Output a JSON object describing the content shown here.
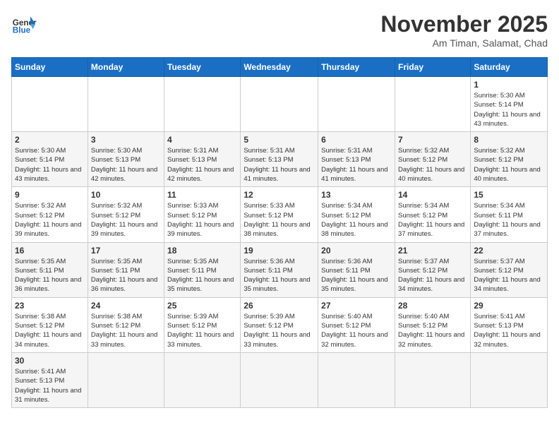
{
  "header": {
    "logo_general": "General",
    "logo_blue": "Blue",
    "month_title": "November 2025",
    "subtitle": "Am Timan, Salamat, Chad"
  },
  "weekdays": [
    "Sunday",
    "Monday",
    "Tuesday",
    "Wednesday",
    "Thursday",
    "Friday",
    "Saturday"
  ],
  "weeks": [
    [
      {
        "day": "",
        "info": ""
      },
      {
        "day": "",
        "info": ""
      },
      {
        "day": "",
        "info": ""
      },
      {
        "day": "",
        "info": ""
      },
      {
        "day": "",
        "info": ""
      },
      {
        "day": "",
        "info": ""
      },
      {
        "day": "1",
        "info": "Sunrise: 5:30 AM\nSunset: 5:14 PM\nDaylight: 11 hours and 43 minutes."
      }
    ],
    [
      {
        "day": "2",
        "info": "Sunrise: 5:30 AM\nSunset: 5:14 PM\nDaylight: 11 hours and 43 minutes."
      },
      {
        "day": "3",
        "info": "Sunrise: 5:30 AM\nSunset: 5:13 PM\nDaylight: 11 hours and 42 minutes."
      },
      {
        "day": "4",
        "info": "Sunrise: 5:31 AM\nSunset: 5:13 PM\nDaylight: 11 hours and 42 minutes."
      },
      {
        "day": "5",
        "info": "Sunrise: 5:31 AM\nSunset: 5:13 PM\nDaylight: 11 hours and 41 minutes."
      },
      {
        "day": "6",
        "info": "Sunrise: 5:31 AM\nSunset: 5:13 PM\nDaylight: 11 hours and 41 minutes."
      },
      {
        "day": "7",
        "info": "Sunrise: 5:32 AM\nSunset: 5:12 PM\nDaylight: 11 hours and 40 minutes."
      },
      {
        "day": "8",
        "info": "Sunrise: 5:32 AM\nSunset: 5:12 PM\nDaylight: 11 hours and 40 minutes."
      }
    ],
    [
      {
        "day": "9",
        "info": "Sunrise: 5:32 AM\nSunset: 5:12 PM\nDaylight: 11 hours and 39 minutes."
      },
      {
        "day": "10",
        "info": "Sunrise: 5:32 AM\nSunset: 5:12 PM\nDaylight: 11 hours and 39 minutes."
      },
      {
        "day": "11",
        "info": "Sunrise: 5:33 AM\nSunset: 5:12 PM\nDaylight: 11 hours and 39 minutes."
      },
      {
        "day": "12",
        "info": "Sunrise: 5:33 AM\nSunset: 5:12 PM\nDaylight: 11 hours and 38 minutes."
      },
      {
        "day": "13",
        "info": "Sunrise: 5:34 AM\nSunset: 5:12 PM\nDaylight: 11 hours and 38 minutes."
      },
      {
        "day": "14",
        "info": "Sunrise: 5:34 AM\nSunset: 5:12 PM\nDaylight: 11 hours and 37 minutes."
      },
      {
        "day": "15",
        "info": "Sunrise: 5:34 AM\nSunset: 5:11 PM\nDaylight: 11 hours and 37 minutes."
      }
    ],
    [
      {
        "day": "16",
        "info": "Sunrise: 5:35 AM\nSunset: 5:11 PM\nDaylight: 11 hours and 36 minutes."
      },
      {
        "day": "17",
        "info": "Sunrise: 5:35 AM\nSunset: 5:11 PM\nDaylight: 11 hours and 36 minutes."
      },
      {
        "day": "18",
        "info": "Sunrise: 5:35 AM\nSunset: 5:11 PM\nDaylight: 11 hours and 35 minutes."
      },
      {
        "day": "19",
        "info": "Sunrise: 5:36 AM\nSunset: 5:11 PM\nDaylight: 11 hours and 35 minutes."
      },
      {
        "day": "20",
        "info": "Sunrise: 5:36 AM\nSunset: 5:11 PM\nDaylight: 11 hours and 35 minutes."
      },
      {
        "day": "21",
        "info": "Sunrise: 5:37 AM\nSunset: 5:12 PM\nDaylight: 11 hours and 34 minutes."
      },
      {
        "day": "22",
        "info": "Sunrise: 5:37 AM\nSunset: 5:12 PM\nDaylight: 11 hours and 34 minutes."
      }
    ],
    [
      {
        "day": "23",
        "info": "Sunrise: 5:38 AM\nSunset: 5:12 PM\nDaylight: 11 hours and 34 minutes."
      },
      {
        "day": "24",
        "info": "Sunrise: 5:38 AM\nSunset: 5:12 PM\nDaylight: 11 hours and 33 minutes."
      },
      {
        "day": "25",
        "info": "Sunrise: 5:39 AM\nSunset: 5:12 PM\nDaylight: 11 hours and 33 minutes."
      },
      {
        "day": "26",
        "info": "Sunrise: 5:39 AM\nSunset: 5:12 PM\nDaylight: 11 hours and 33 minutes."
      },
      {
        "day": "27",
        "info": "Sunrise: 5:40 AM\nSunset: 5:12 PM\nDaylight: 11 hours and 32 minutes."
      },
      {
        "day": "28",
        "info": "Sunrise: 5:40 AM\nSunset: 5:12 PM\nDaylight: 11 hours and 32 minutes."
      },
      {
        "day": "29",
        "info": "Sunrise: 5:41 AM\nSunset: 5:13 PM\nDaylight: 11 hours and 32 minutes."
      }
    ],
    [
      {
        "day": "30",
        "info": "Sunrise: 5:41 AM\nSunset: 5:13 PM\nDaylight: 11 hours and 31 minutes."
      },
      {
        "day": "",
        "info": ""
      },
      {
        "day": "",
        "info": ""
      },
      {
        "day": "",
        "info": ""
      },
      {
        "day": "",
        "info": ""
      },
      {
        "day": "",
        "info": ""
      },
      {
        "day": "",
        "info": ""
      }
    ]
  ]
}
